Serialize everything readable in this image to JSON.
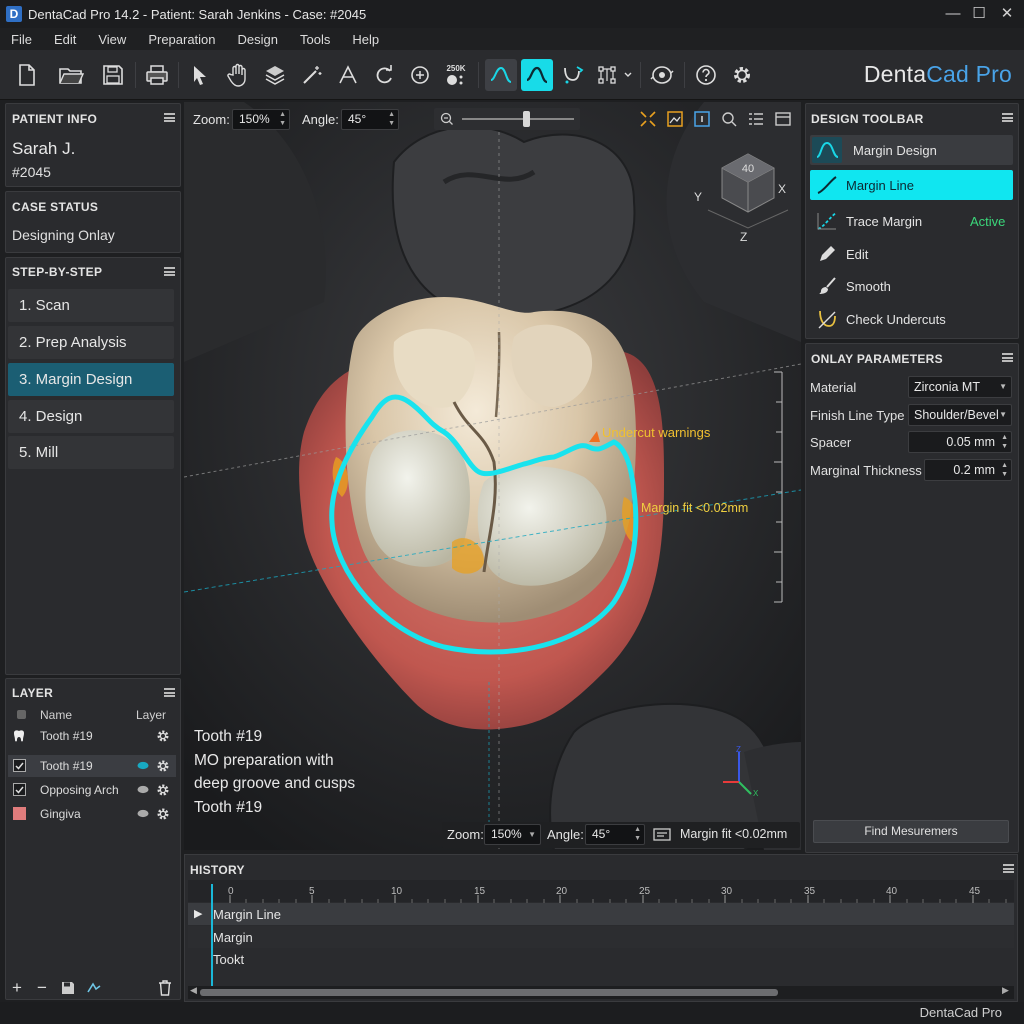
{
  "window": {
    "title": "DentaCad Pro 14.2 - Patient: Sarah Jenkins - Case: #2045",
    "logo_letter": "D",
    "minimize": "—",
    "maximize": "☐",
    "close": "✕"
  },
  "menu": [
    "File",
    "Edit",
    "View",
    "Preparation",
    "Design",
    "Tools",
    "Help"
  ],
  "toolbar": {
    "brand_prefix": "Denta",
    "brand_accent": "Cad Pro",
    "counter_badge": "250K"
  },
  "patient_info": {
    "title": "PATIENT INFO",
    "name": "Sarah J.",
    "case": "#2045"
  },
  "case_status": {
    "title": "CASE STATUS",
    "value": "Designing Onlay"
  },
  "steps": {
    "title": "STEP-BY-STEP",
    "items": [
      {
        "label": "1. Scan"
      },
      {
        "label": "2. Prep Analysis"
      },
      {
        "label": "3. Margin Design",
        "active": true
      },
      {
        "label": "4. Design"
      },
      {
        "label": "5. Mill"
      }
    ]
  },
  "layers": {
    "title": "LAYER",
    "col_name": "Name",
    "col_layer": "Layer",
    "rows": [
      {
        "name": "Tooth #19",
        "kind": "tooth"
      },
      {
        "name": "Tooth #19",
        "kind": "checkbox",
        "checked": true,
        "selected": true
      },
      {
        "name": "Opposing Arch",
        "kind": "checkbox",
        "checked": true
      },
      {
        "name": "Gingiva",
        "kind": "swatch",
        "color": "#e07c7c"
      }
    ]
  },
  "viewport": {
    "zoom_label": "Zoom:",
    "zoom_value": "150%",
    "angle_label": "Angle:",
    "angle_value": "45°",
    "slider_level": 0.58,
    "cube_face": "40",
    "axis_x": "X",
    "axis_y": "Y",
    "axis_z": "Z",
    "annotation_undercut": "Undercut warnings",
    "annotation_fit": "Margin fit <0.02mm",
    "description": [
      "Tooth #19",
      "MO preparation with",
      "deep groove and cusps",
      "Tooth #19"
    ],
    "bottom_zoom_label": "Zoom:",
    "bottom_zoom_value": "150%",
    "bottom_angle_label": "Angle:",
    "bottom_angle_value": "45°",
    "bottom_fit": "Margin fit <0.02mm",
    "colors": {
      "margin_line": "#19e3ee",
      "gingiva": "#c45a5a",
      "warning": "#e8a020"
    }
  },
  "design_toolbar": {
    "title": "DESIGN TOOLBAR",
    "items": [
      {
        "label": "Margin Design",
        "icon": "margin-curve-icon"
      },
      {
        "label": "Margin Line",
        "icon": "margin-line-icon",
        "active": true
      },
      {
        "label": "Trace Margin",
        "icon": "trace-margin-icon",
        "status": "Active"
      },
      {
        "label": "Edit",
        "icon": "pencil-icon"
      },
      {
        "label": "Smooth",
        "icon": "brush-icon"
      },
      {
        "label": "Check Undercuts",
        "icon": "undercut-icon"
      }
    ],
    "accent": "#10e6f0"
  },
  "onlay": {
    "title": "ONLAY PARAMETERS",
    "params": [
      {
        "label": "Material",
        "value": "Zirconia MT",
        "control": "dropdown"
      },
      {
        "label": "Finish Line Type",
        "value": "Shoulder/Bevel",
        "control": "dropdown"
      },
      {
        "label": "Spacer",
        "value": "0.05 mm",
        "control": "spinner"
      },
      {
        "label": "Marginal Thickness",
        "value": "0.2 mm",
        "control": "spinner"
      }
    ],
    "find_button": "Find Mesuremers"
  },
  "history": {
    "title": "HISTORY",
    "ticks": [
      "0",
      "5",
      "10",
      "15",
      "20",
      "25",
      "30",
      "35",
      "40",
      "45"
    ],
    "rows": [
      "Margin Line",
      "Margin",
      "Tookt"
    ],
    "scroll_fraction": 0.75
  },
  "status": {
    "brand": "DentaCad Pro"
  }
}
